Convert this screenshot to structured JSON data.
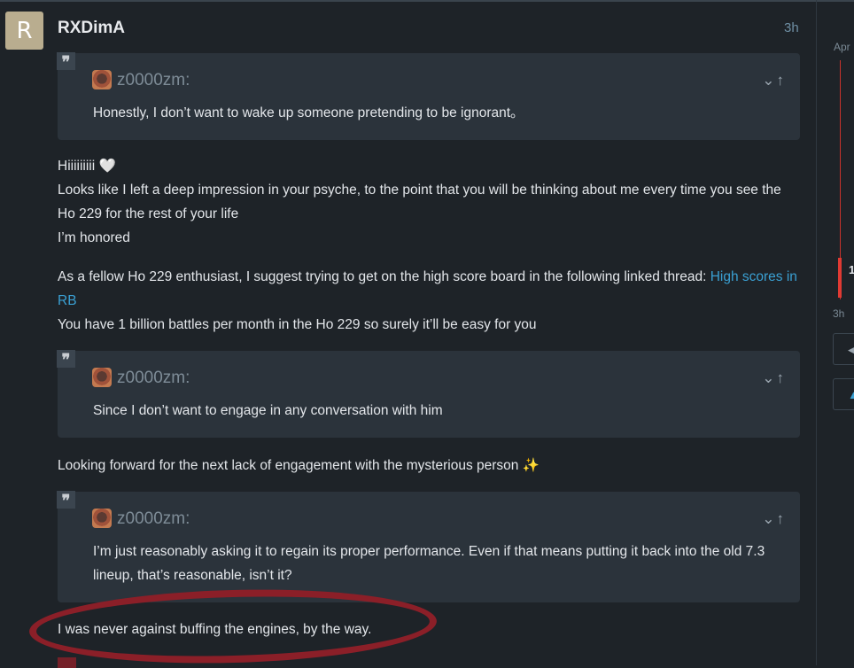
{
  "post": {
    "avatar_letter": "R",
    "username": "RXDimA",
    "time": "3h"
  },
  "quotes": [
    {
      "author": "z0000zm:",
      "text": "Honestly, I don’t want to wake up someone pretending to be ignorant。"
    },
    {
      "author": "z0000zm:",
      "text": "Since I don’t want to engage in any conversation with him"
    },
    {
      "author": "z0000zm:",
      "text": "I’m just reasonably asking it to regain its proper performance. Even if that means putting it back into the old 7.3 lineup, that’s reasonable, isn’t it?"
    }
  ],
  "body": {
    "line1": "Hiiiiiiiii 🤍",
    "line2": "Looks like I left a deep impression in your psyche, to the point that you will be thinking about me every time you see the Ho 229 for the rest of your life",
    "line3": "I’m honored",
    "para2_text": "As a fellow Ho 229 enthusiast, I suggest trying to get on the high score board in the following linked thread: ",
    "para2_link": "High scores in RB",
    "para2_line2": "You have 1 billion battles per month in the Ho 229 so surely it’ll be easy for you",
    "para3": "Looking forward for the next lack of engagement with the mysterious person ✨",
    "para4": "I was never against buffing the engines, by the way."
  },
  "timeline": {
    "top_label": "Apr",
    "bottom_label": "3h",
    "current_count": "1"
  },
  "colors": {
    "background": "#1e2328",
    "quote_bg": "#2b333b",
    "link": "#3aa0d3",
    "annotation_red": "#8b1f28",
    "timeline_red": "#e03a33"
  },
  "icons": [
    "quote-icon",
    "chevron-down-icon",
    "arrow-up-icon",
    "reply-icon",
    "flag-icon"
  ]
}
